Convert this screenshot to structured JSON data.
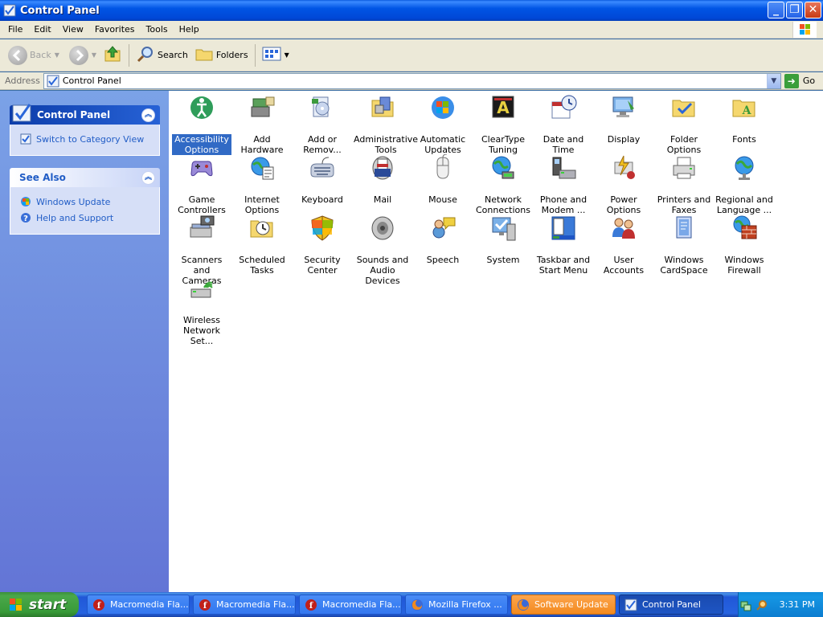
{
  "window": {
    "title": "Control Panel"
  },
  "menu": {
    "items": [
      "File",
      "Edit",
      "View",
      "Favorites",
      "Tools",
      "Help"
    ]
  },
  "toolbar": {
    "back_label": "Back",
    "search_label": "Search",
    "folders_label": "Folders"
  },
  "address": {
    "label": "Address",
    "value": "Control Panel",
    "go_label": "Go"
  },
  "left_pane": {
    "control_panel": {
      "title": "Control Panel",
      "links": [
        "Switch to Category View"
      ]
    },
    "see_also": {
      "title": "See Also",
      "links": [
        "Windows Update",
        "Help and Support"
      ]
    }
  },
  "items": [
    {
      "label": "Accessibility Options",
      "icon": "accessibility-icon",
      "selected": true
    },
    {
      "label": "Add Hardware",
      "icon": "add-hardware-icon"
    },
    {
      "label": "Add or Remov...",
      "icon": "add-remove-programs-icon"
    },
    {
      "label": "Administrative Tools",
      "icon": "administrative-tools-icon"
    },
    {
      "label": "Automatic Updates",
      "icon": "automatic-updates-icon"
    },
    {
      "label": "ClearType Tuning",
      "icon": "cleartype-icon"
    },
    {
      "label": "Date and Time",
      "icon": "date-time-icon"
    },
    {
      "label": "Display",
      "icon": "display-icon"
    },
    {
      "label": "Folder Options",
      "icon": "folder-options-icon"
    },
    {
      "label": "Fonts",
      "icon": "fonts-icon"
    },
    {
      "label": "Game Controllers",
      "icon": "game-controller-icon"
    },
    {
      "label": "Internet Options",
      "icon": "internet-options-icon"
    },
    {
      "label": "Keyboard",
      "icon": "keyboard-icon"
    },
    {
      "label": "Mail",
      "icon": "mail-icon"
    },
    {
      "label": "Mouse",
      "icon": "mouse-icon"
    },
    {
      "label": "Network Connections",
      "icon": "network-connections-icon"
    },
    {
      "label": "Phone and Modem ...",
      "icon": "phone-modem-icon"
    },
    {
      "label": "Power Options",
      "icon": "power-options-icon"
    },
    {
      "label": "Printers and Faxes",
      "icon": "printers-faxes-icon"
    },
    {
      "label": "Regional and Language ...",
      "icon": "regional-language-icon"
    },
    {
      "label": "Scanners and Cameras",
      "icon": "scanners-cameras-icon"
    },
    {
      "label": "Scheduled Tasks",
      "icon": "scheduled-tasks-icon"
    },
    {
      "label": "Security Center",
      "icon": "security-center-icon"
    },
    {
      "label": "Sounds and Audio Devices",
      "icon": "sounds-audio-icon"
    },
    {
      "label": "Speech",
      "icon": "speech-icon"
    },
    {
      "label": "System",
      "icon": "system-icon"
    },
    {
      "label": "Taskbar and Start Menu",
      "icon": "taskbar-start-menu-icon"
    },
    {
      "label": "User Accounts",
      "icon": "user-accounts-icon"
    },
    {
      "label": "Windows CardSpace",
      "icon": "cardspace-icon"
    },
    {
      "label": "Windows Firewall",
      "icon": "firewall-icon"
    },
    {
      "label": "Wireless Network Set...",
      "icon": "wireless-network-icon"
    }
  ],
  "taskbar": {
    "start_label": "start",
    "tasks": [
      {
        "label": "Macromedia Fla...",
        "icon": "flash-icon"
      },
      {
        "label": "Macromedia Fla...",
        "icon": "flash-icon"
      },
      {
        "label": "Macromedia Fla...",
        "icon": "flash-icon"
      },
      {
        "label": "Mozilla Firefox ...",
        "icon": "firefox-icon"
      },
      {
        "label": "Software Update",
        "icon": "firefox-icon",
        "style": "orange"
      },
      {
        "label": "Control Panel",
        "icon": "control-panel-icon",
        "style": "active"
      }
    ],
    "clock": "3:31 PM"
  },
  "colors": {
    "titlebar": "#0055e5",
    "selection": "#316ac5",
    "link": "#215dc6",
    "start_green": "#3c9a3c"
  }
}
